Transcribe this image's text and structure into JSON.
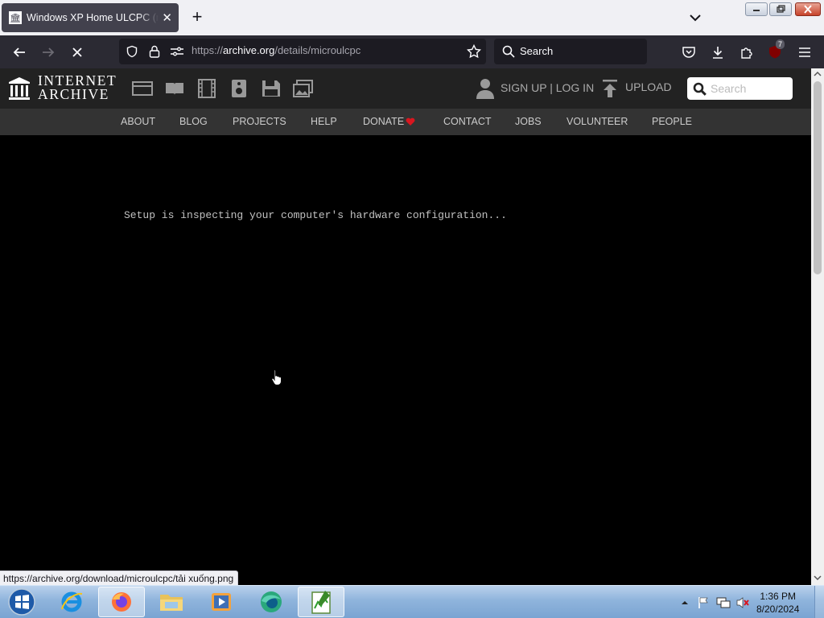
{
  "browser": {
    "tab_title": "Windows XP Home ULCPC (microulcpc)",
    "new_tab_symbol": "+",
    "url_prefix": "https://",
    "url_domain": "archive.org",
    "url_path": "/details/microulcpc",
    "search_placeholder": "Search",
    "extension_badge": "7",
    "status_link": "https://archive.org/download/microulcpc/tải xuống.png"
  },
  "ia": {
    "logo_line1": "INTERNET",
    "logo_line2": "ARCHIVE",
    "media_icons": [
      "web-icon",
      "texts-icon",
      "video-icon",
      "audio-icon",
      "software-icon",
      "images-icon"
    ],
    "signup_label": "SIGN UP | LOG IN",
    "upload_label": "UPLOAD",
    "search_placeholder": "Search",
    "nav": [
      "ABOUT",
      "BLOG",
      "PROJECTS",
      "HELP",
      "DONATE",
      "CONTACT",
      "JOBS",
      "VOLUNTEER",
      "PEOPLE"
    ]
  },
  "emulator": {
    "setup_text": "Setup is inspecting your computer's hardware configuration..."
  },
  "taskbar": {
    "apps": [
      "start-orb",
      "internet-explorer",
      "firefox",
      "windows-explorer",
      "media-player",
      "edge-like-app",
      "task-manager"
    ],
    "time": "1:36 PM",
    "date": "8/20/2024"
  },
  "colors": {
    "accent_red": "#d9161f",
    "page_bg": "#000000",
    "ia_header": "#222222",
    "ia_nav": "#333333"
  }
}
